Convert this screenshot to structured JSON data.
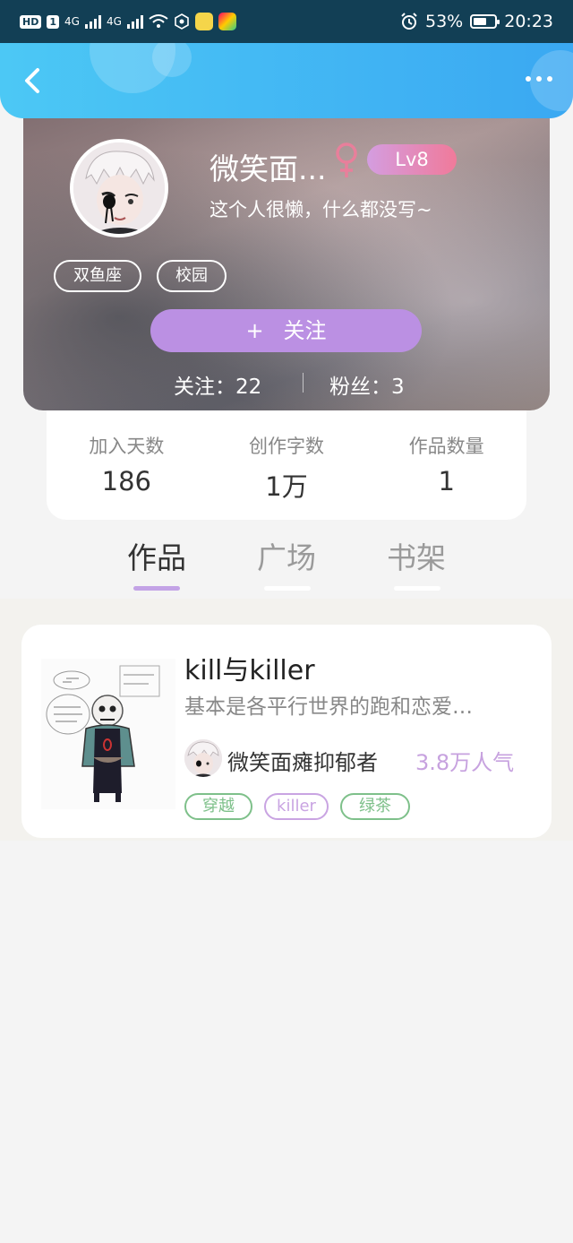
{
  "status_bar": {
    "hd_label": "HD",
    "sim_label": "1",
    "network_1": "4G",
    "network_2": "4G",
    "battery_percent": "53%",
    "time": "20:23"
  },
  "header": {
    "back_icon": "chevron-left-icon",
    "more_icon": "more-dots-icon"
  },
  "profile": {
    "nickname": "微笑面...",
    "gender_icon": "female-icon",
    "level": "Lv8",
    "bio": "这个人很懒，什么都没写~",
    "tags": [
      "双鱼座",
      "校园"
    ],
    "follow_button": "关注",
    "follow_plus": "+",
    "following": "关注：22",
    "fans": "粉丝：3"
  },
  "info": [
    {
      "label": "加入天数",
      "value": "186"
    },
    {
      "label": "创作字数",
      "value": "1万"
    },
    {
      "label": "作品数量",
      "value": "1"
    }
  ],
  "tabs": [
    {
      "label": "作品",
      "active": true
    },
    {
      "label": "广场",
      "active": false
    },
    {
      "label": "书架",
      "active": false
    }
  ],
  "works": [
    {
      "title": "kill与killer",
      "description": "基本是各平行世界的跑和恋爱…",
      "author": "微笑面瘫抑郁者",
      "popularity": "3.8万人气",
      "tags": [
        {
          "label": "穿越",
          "color": "#7ec08a"
        },
        {
          "label": "killer",
          "color": "#c9a4e2"
        },
        {
          "label": "绿茶",
          "color": "#7ec08a"
        }
      ]
    }
  ],
  "colors": {
    "accent_blue": "#3aa8f2",
    "follow_purple": "#bb90e3",
    "tab_active_underline": "#c3a3e6",
    "popularity": "#c7a2df"
  }
}
